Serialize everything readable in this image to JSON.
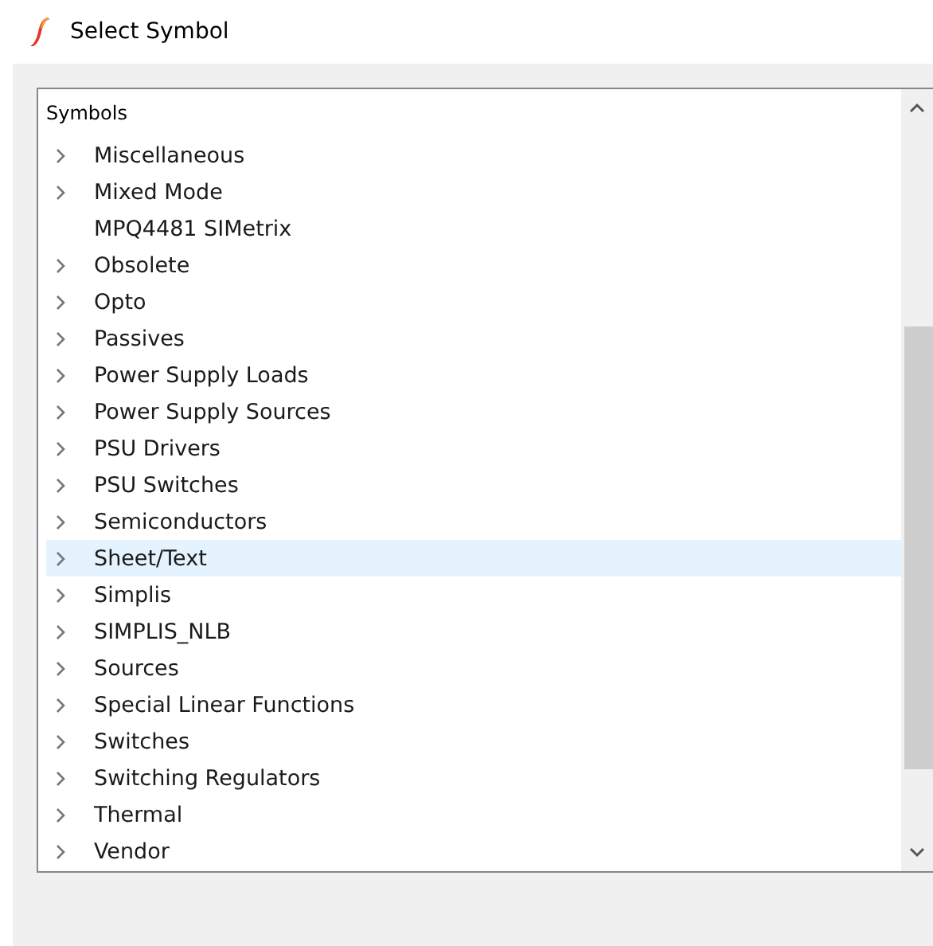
{
  "window": {
    "title": "Select Symbol"
  },
  "tree": {
    "header": "Symbols",
    "items": [
      {
        "label": "Miscellaneous",
        "expandable": true,
        "selected": false
      },
      {
        "label": "Mixed Mode",
        "expandable": true,
        "selected": false
      },
      {
        "label": "MPQ4481 SIMetrix",
        "expandable": false,
        "selected": false
      },
      {
        "label": "Obsolete",
        "expandable": true,
        "selected": false
      },
      {
        "label": "Opto",
        "expandable": true,
        "selected": false
      },
      {
        "label": "Passives",
        "expandable": true,
        "selected": false
      },
      {
        "label": "Power Supply Loads",
        "expandable": true,
        "selected": false
      },
      {
        "label": "Power Supply Sources",
        "expandable": true,
        "selected": false
      },
      {
        "label": "PSU Drivers",
        "expandable": true,
        "selected": false
      },
      {
        "label": "PSU Switches",
        "expandable": true,
        "selected": false
      },
      {
        "label": "Semiconductors",
        "expandable": true,
        "selected": false
      },
      {
        "label": "Sheet/Text",
        "expandable": true,
        "selected": true
      },
      {
        "label": "Simplis",
        "expandable": true,
        "selected": false
      },
      {
        "label": "SIMPLIS_NLB",
        "expandable": true,
        "selected": false
      },
      {
        "label": "Sources",
        "expandable": true,
        "selected": false
      },
      {
        "label": "Special Linear Functions",
        "expandable": true,
        "selected": false
      },
      {
        "label": "Switches",
        "expandable": true,
        "selected": false
      },
      {
        "label": "Switching Regulators",
        "expandable": true,
        "selected": false
      },
      {
        "label": "Thermal",
        "expandable": true,
        "selected": false
      },
      {
        "label": "Vendor",
        "expandable": true,
        "selected": false
      }
    ]
  }
}
